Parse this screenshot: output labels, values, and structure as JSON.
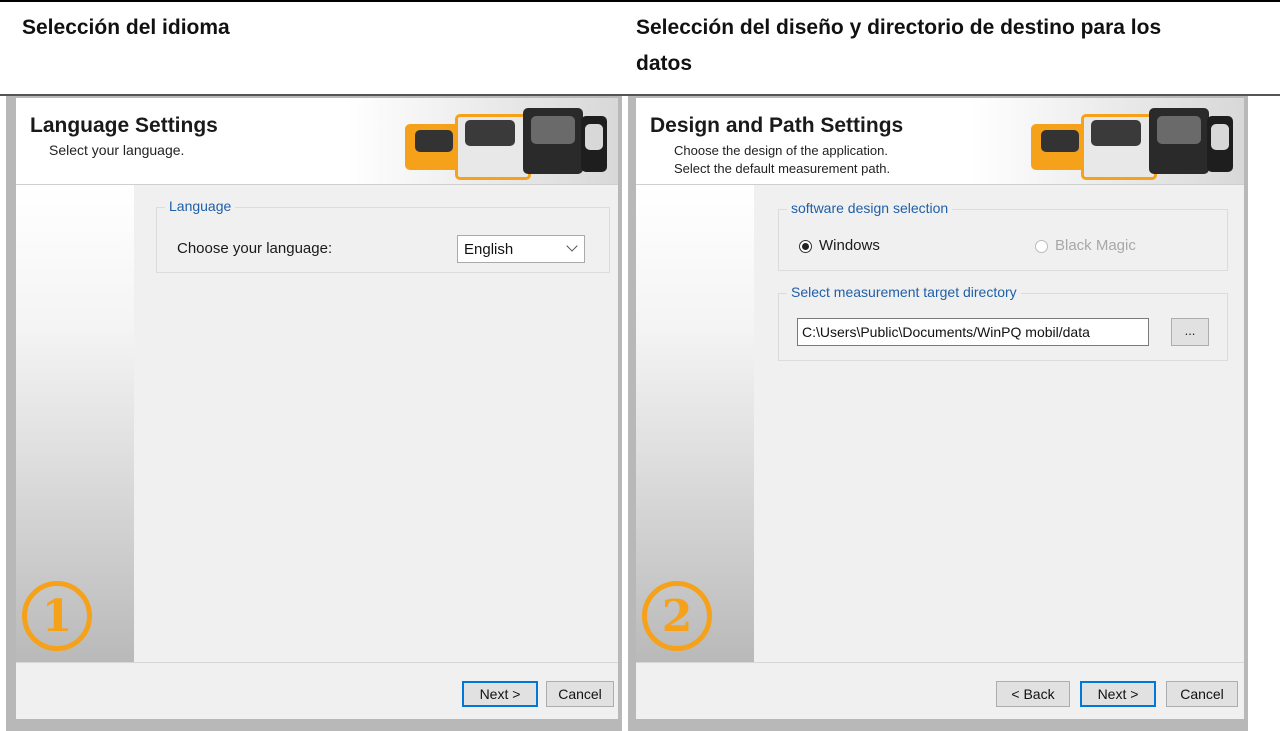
{
  "captions": {
    "left": "Selección del idioma",
    "right_line1": "Selección del diseño y directorio de destino para los",
    "right_line2": "datos"
  },
  "dialog1": {
    "title": "Language Settings",
    "subtitle": "Select your language.",
    "group_legend": "Language",
    "choose_label": "Choose your language:",
    "language_value": "English",
    "step_number": "1",
    "next_label": "Next >",
    "cancel_label": "Cancel"
  },
  "dialog2": {
    "title": "Design and Path Settings",
    "subtitle_line1": "Choose the design of the application.",
    "subtitle_line2": "Select the default measurement path.",
    "design_legend": "software design selection",
    "option_windows": "Windows",
    "option_black_magic": "Black Magic",
    "selected_design": "Windows",
    "path_legend": "Select measurement target directory",
    "path_value": "C:\\Users\\Public\\Documents/WinPQ mobil/data",
    "browse_label": "...",
    "step_number": "2",
    "back_label": "< Back",
    "next_label": "Next >",
    "cancel_label": "Cancel"
  },
  "colors": {
    "accent_orange": "#f5a11a",
    "legend_blue": "#1f5fa8",
    "default_button_border": "#0078d7"
  }
}
